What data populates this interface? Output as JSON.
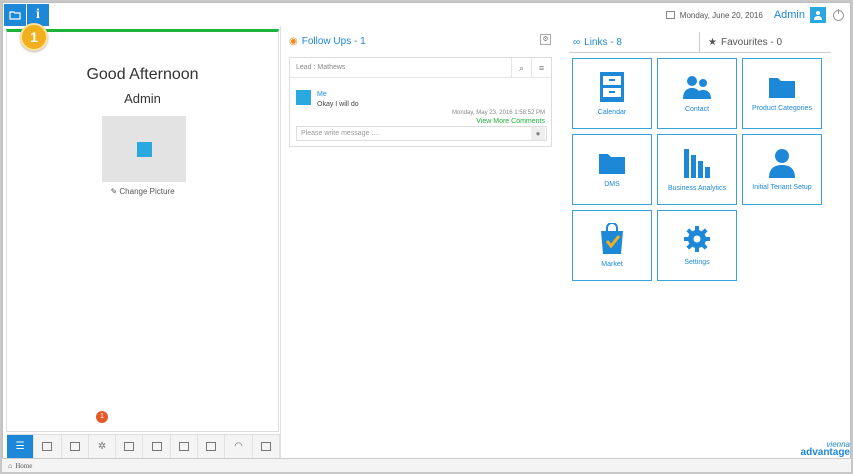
{
  "topbar": {
    "badge": "1",
    "info_label": "i",
    "date": "Monday, June 20, 2016",
    "user": "Admin"
  },
  "profile": {
    "greeting": "Good Afternoon",
    "name": "Admin",
    "change_picture": "Change Picture",
    "notification_count": "1"
  },
  "followups": {
    "title": "Follow Ups - 1",
    "lead": "Lead : Mathews",
    "user": "Me",
    "message": "Okay I will do",
    "timestamp": "Monday, May 23, 2016 1:58:52 PM",
    "view_more": "View More Comments",
    "placeholder": "Please write message ...."
  },
  "links": {
    "tab_links": "Links - 8",
    "tab_favourites": "Favourites - 0",
    "items": [
      {
        "label": "Calendar",
        "icon": "calendar-icon"
      },
      {
        "label": "Contact",
        "icon": "contact-icon"
      },
      {
        "label": "Product Categories",
        "icon": "folder-icon"
      },
      {
        "label": "DMS",
        "icon": "folder-icon"
      },
      {
        "label": "Business Analytics",
        "icon": "bar-chart-icon"
      },
      {
        "label": "Initial Tenant Setup",
        "icon": "user-icon"
      },
      {
        "label": "Market",
        "icon": "shopping-bag-icon"
      },
      {
        "label": "Settings",
        "icon": "gear-icon"
      }
    ]
  },
  "footer": {
    "home": "Home"
  },
  "brand": {
    "line1": "vienna",
    "line2": "advantage"
  },
  "colors": {
    "accent": "#1e88d8",
    "green": "#1db33a",
    "badge": "#f2b01e"
  }
}
